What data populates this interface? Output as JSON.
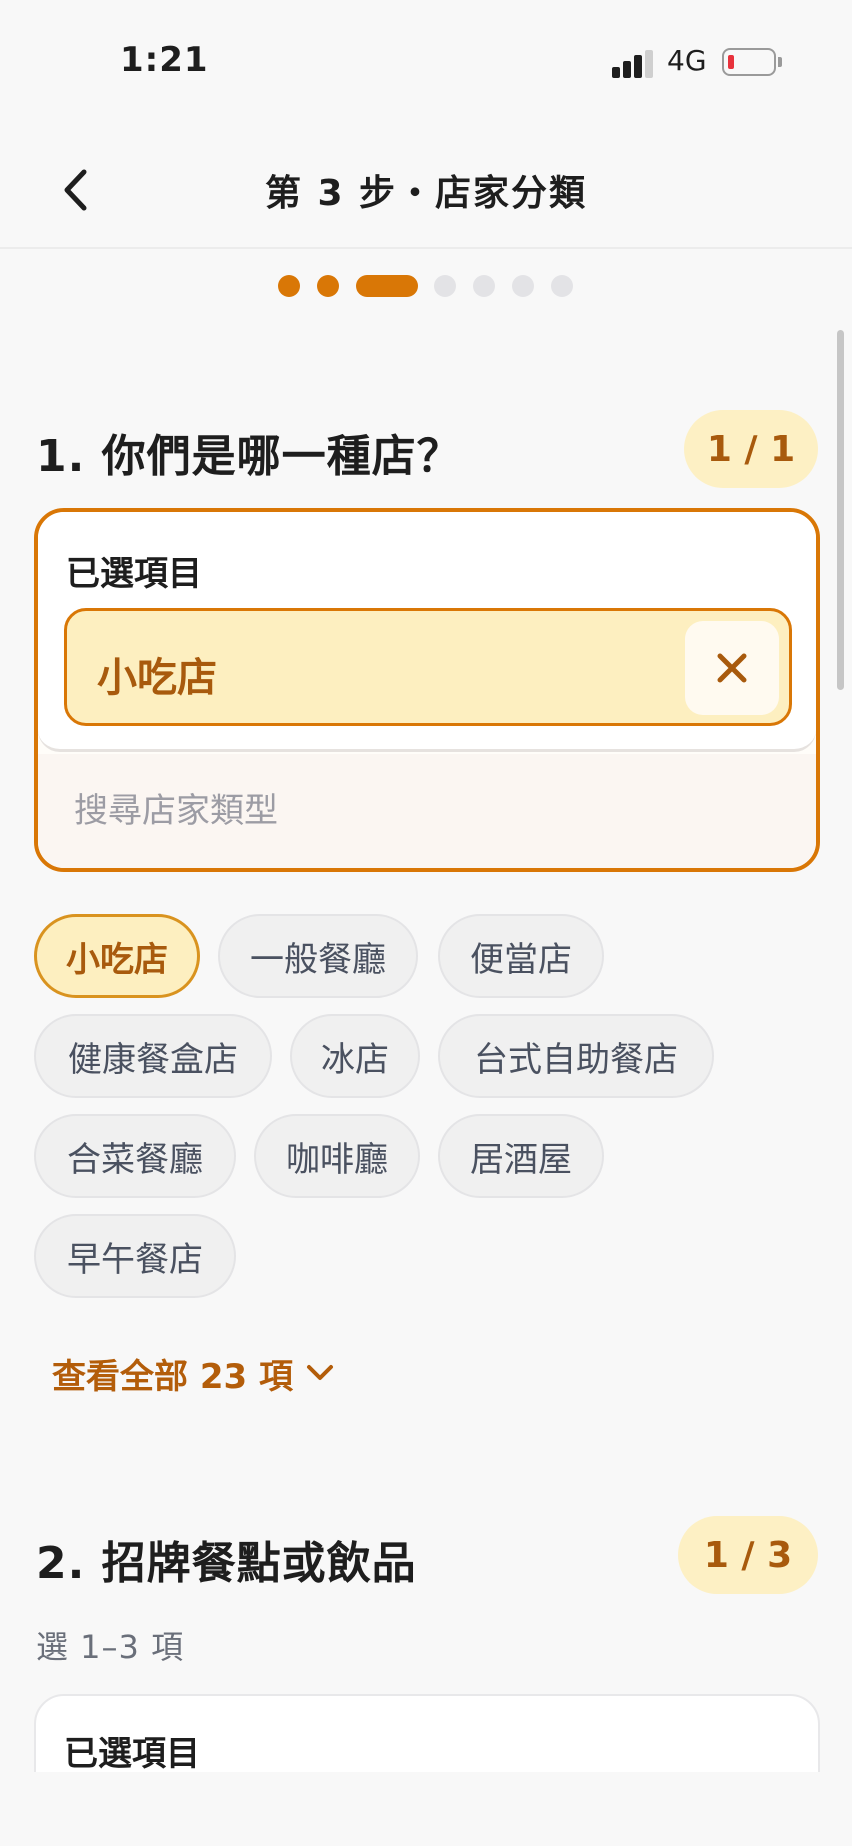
{
  "status_bar": {
    "time": "1:21",
    "network": "4G"
  },
  "header": {
    "title": "第 3 步・店家分類"
  },
  "progress": {
    "total_steps": 7,
    "current_step": 3
  },
  "section1": {
    "title": "1. 你們是哪一種店？",
    "count": "1 / 1",
    "selected_label": "已選項目",
    "selected_item": "小吃店",
    "search_placeholder": "搜尋店家類型",
    "options": [
      {
        "label": "小吃店",
        "selected": true
      },
      {
        "label": "一般餐廳",
        "selected": false
      },
      {
        "label": "便當店",
        "selected": false
      },
      {
        "label": "健康餐盒店",
        "selected": false
      },
      {
        "label": "冰店",
        "selected": false
      },
      {
        "label": "台式自助餐店",
        "selected": false
      },
      {
        "label": "合菜餐廳",
        "selected": false
      },
      {
        "label": "咖啡廳",
        "selected": false
      },
      {
        "label": "居酒屋",
        "selected": false
      },
      {
        "label": "早午餐店",
        "selected": false
      }
    ],
    "view_all": "查看全部 23 項"
  },
  "section2": {
    "title": "2. 招牌餐點或飲品",
    "count": "1 / 3",
    "hint": "選 1–3 項",
    "selected_label": "已選項目"
  },
  "colors": {
    "accent": "#d97706",
    "accent_text": "#a85a0d",
    "accent_bg": "#fdefc0",
    "battery_low": "#e8323c"
  },
  "icons": {
    "back": "chevron-left-icon",
    "remove": "close-icon",
    "expand": "chevron-down-icon"
  }
}
